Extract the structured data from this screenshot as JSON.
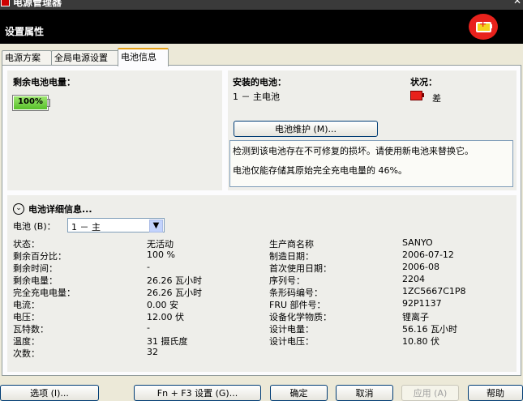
{
  "window": {
    "title": "电源管理器",
    "close_glyph": "✕"
  },
  "header": {
    "title": "设置属性",
    "icon": "battery-charging-icon"
  },
  "tabs": [
    {
      "label": "电源方案"
    },
    {
      "label": "全局电源设置"
    },
    {
      "label": "电池信息"
    }
  ],
  "remaining": {
    "title": "剩余电池电量：",
    "percent_text": "100%",
    "level": 1.0
  },
  "installed": {
    "title": "安装的电池：",
    "item": "1 － 主电池"
  },
  "status": {
    "title": "状况：",
    "value": "差",
    "icon": "battery-red-icon"
  },
  "maintenance_button": "电池维护 (M)...",
  "messages": {
    "line1": "检测到该电池存在不可修复的损坏。请使用新电池来替换它。",
    "line2": "电池仅能存储其原始完全充电电量的 46%。"
  },
  "details": {
    "title": "电池详细信息...",
    "battery_select_label": "电池 (B)：",
    "battery_select_value": "1 － 主",
    "left": [
      {
        "label": "状态：",
        "value": "无活动"
      },
      {
        "label": "剩余百分比：",
        "value": "100 %"
      },
      {
        "label": "剩余时间：",
        "value": "-"
      },
      {
        "label": "剩余电量：",
        "value": "26.26 瓦小时"
      },
      {
        "label": "完全充电电量：",
        "value": "26.26 瓦小时"
      },
      {
        "label": "电流：",
        "value": "0.00 安"
      },
      {
        "label": "电压：",
        "value": "12.00 伏"
      },
      {
        "label": "瓦特数：",
        "value": "-"
      },
      {
        "label": "温度：",
        "value": "31 摄氏度"
      },
      {
        "label": "次数：",
        "value": "32"
      }
    ],
    "right": [
      {
        "label": "生产商名称",
        "value": "SANYO"
      },
      {
        "label": "制造日期：",
        "value": "2006-07-12"
      },
      {
        "label": "首次使用日期：",
        "value": "2006-08"
      },
      {
        "label": "序列号：",
        "value": "2204"
      },
      {
        "label": "条形码编号：",
        "value": "1ZC5667C1P8"
      },
      {
        "label": "FRU 部件号：",
        "value": "92P1137"
      },
      {
        "label": "设备化学物质：",
        "value": "锂离子"
      },
      {
        "label": "设计电量：",
        "value": "56.16 瓦小时"
      },
      {
        "label": "设计电压：",
        "value": "10.80 伏"
      }
    ]
  },
  "buttons": {
    "options": "选项 (I)...",
    "fn_f3": "Fn + F3 设置 (G)...",
    "ok": "确定",
    "cancel": "取消",
    "apply": "应用 (A)",
    "help": "帮助"
  }
}
